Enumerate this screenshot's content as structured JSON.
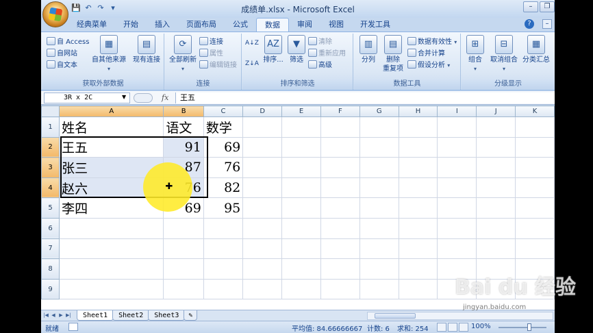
{
  "window": {
    "title": "成绩单.xlsx - Microsoft Excel"
  },
  "qat": {
    "save": "💾",
    "undo": "↶",
    "redo": "↷",
    "more": "▾"
  },
  "tabs": [
    {
      "label": "经典菜单"
    },
    {
      "label": "开始"
    },
    {
      "label": "插入"
    },
    {
      "label": "页面布局"
    },
    {
      "label": "公式"
    },
    {
      "label": "数据"
    },
    {
      "label": "审阅"
    },
    {
      "label": "视图"
    },
    {
      "label": "开发工具"
    }
  ],
  "active_tab": "数据",
  "ribbon": {
    "get_external": {
      "label": "获取外部数据",
      "access": "自 Access",
      "web": "自网站",
      "text": "自文本",
      "other": "自其他来源",
      "existing": "现有连接"
    },
    "connections": {
      "label": "连接",
      "refresh_all": "全部刷新",
      "conn": "连接",
      "props": "属性",
      "edit_links": "编辑链接"
    },
    "sort_filter": {
      "label": "排序和筛选",
      "sort_asc": "A↓Z",
      "sort_desc": "Z↓A",
      "sort": "排序...",
      "filter": "筛选",
      "clear": "清除",
      "reapply": "重新应用",
      "advanced": "高级"
    },
    "data_tools": {
      "label": "数据工具",
      "split": "分列",
      "remove_dup_1": "删除",
      "remove_dup_2": "重复项",
      "validation": "数据有效性",
      "consolidate": "合并计算",
      "whatif": "假设分析"
    },
    "outline": {
      "label": "分级显示",
      "group": "组合",
      "ungroup": "取消组合",
      "subtotal": "分类汇总"
    }
  },
  "formula_bar": {
    "name_box": "3R x 2C",
    "fx": "fx",
    "content": "王五"
  },
  "grid": {
    "columns": [
      "A",
      "B",
      "C",
      "D",
      "E",
      "F",
      "G",
      "H",
      "I",
      "J",
      "K"
    ],
    "rows": [
      {
        "num": "1",
        "a": "姓名",
        "b": "语文",
        "c": "数学"
      },
      {
        "num": "2",
        "a": "王五",
        "b": "91",
        "c": "69"
      },
      {
        "num": "3",
        "a": "张三",
        "b": "87",
        "c": "76"
      },
      {
        "num": "4",
        "a": "赵六",
        "b": "76",
        "c": "82"
      },
      {
        "num": "5",
        "a": "李四",
        "b": "69",
        "c": "95"
      },
      {
        "num": "6",
        "a": "",
        "b": "",
        "c": ""
      },
      {
        "num": "7",
        "a": "",
        "b": "",
        "c": ""
      },
      {
        "num": "8",
        "a": "",
        "b": "",
        "c": ""
      },
      {
        "num": "9",
        "a": "",
        "b": "",
        "c": ""
      }
    ],
    "selected_columns": [
      "A",
      "B"
    ],
    "selected_rows": [
      "2",
      "3",
      "4"
    ]
  },
  "sheets": [
    {
      "label": "Sheet1",
      "active": true
    },
    {
      "label": "Sheet2"
    },
    {
      "label": "Sheet3"
    }
  ],
  "status": {
    "ready": "就绪",
    "average": "平均值: 84.66666667",
    "count": "计数: 6",
    "sum": "求和: 254",
    "zoom": "100%"
  },
  "watermark": {
    "brand": "Bai du 经验",
    "url": "jingyan.baidu.com"
  }
}
